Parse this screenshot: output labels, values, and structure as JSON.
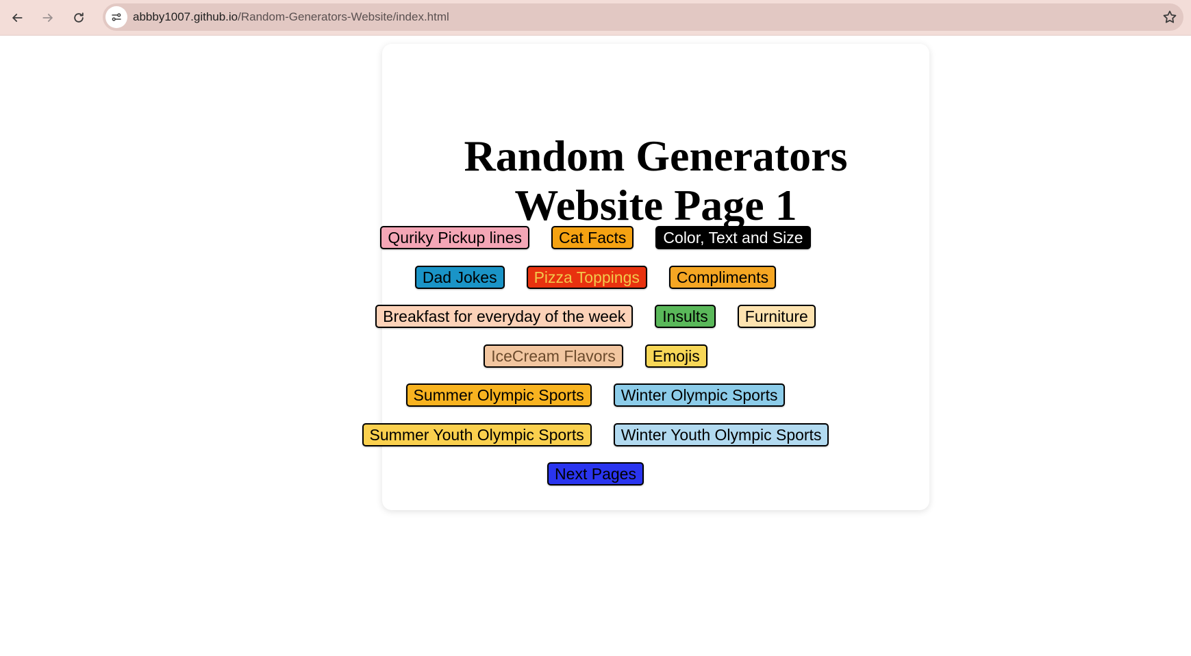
{
  "browser": {
    "url_host": "abbby1007.github.io",
    "url_path": "/Random-Generators-Website/index.html",
    "icons": [
      "back-arrow-icon",
      "forward-arrow-icon",
      "reload-icon",
      "site-info-icon",
      "bookmark-star-icon"
    ]
  },
  "page": {
    "title_line1": "Random Generators",
    "title_line2": "Website Page 1",
    "buttons": [
      {
        "label": "Quriky Pickup lines",
        "bg": "#f4a6b6",
        "fg": "#000000"
      },
      {
        "label": "Cat Facts",
        "bg": "#f5a212",
        "fg": "#000000"
      },
      {
        "label": "Color, Text and Size",
        "bg": "#000000",
        "fg": "#ffffff"
      },
      {
        "label": "Dad Jokes",
        "bg": "#1a94c7",
        "fg": "#000000"
      },
      {
        "label": "Pizza Toppings",
        "bg": "#e8320f",
        "fg": "#f2c94c"
      },
      {
        "label": "Compliments",
        "bg": "#f5a623",
        "fg": "#000000"
      },
      {
        "label": "Breakfast for everyday of the week",
        "bg": "#fcd2b8",
        "fg": "#000000"
      },
      {
        "label": "Insults",
        "bg": "#5ab85a",
        "fg": "#000000"
      },
      {
        "label": "Furniture",
        "bg": "#fde3b0",
        "fg": "#000000"
      },
      {
        "label": "IceCream Flavors",
        "bg": "#f2c6a0",
        "fg": "#6b4a2c"
      },
      {
        "label": "Emojis",
        "bg": "#f7d757",
        "fg": "#000000"
      },
      {
        "label": "Summer Olympic Sports",
        "bg": "#f8b320",
        "fg": "#000000"
      },
      {
        "label": "Winter Olympic Sports",
        "bg": "#8ccce9",
        "fg": "#000000"
      },
      {
        "label": "Summer Youth Olympic Sports",
        "bg": "#fad04e",
        "fg": "#000000"
      },
      {
        "label": "Winter Youth Olympic Sports",
        "bg": "#b2daf0",
        "fg": "#000000"
      },
      {
        "label": "Next Pages",
        "bg": "#2a35ef",
        "fg": "#000000"
      }
    ]
  }
}
